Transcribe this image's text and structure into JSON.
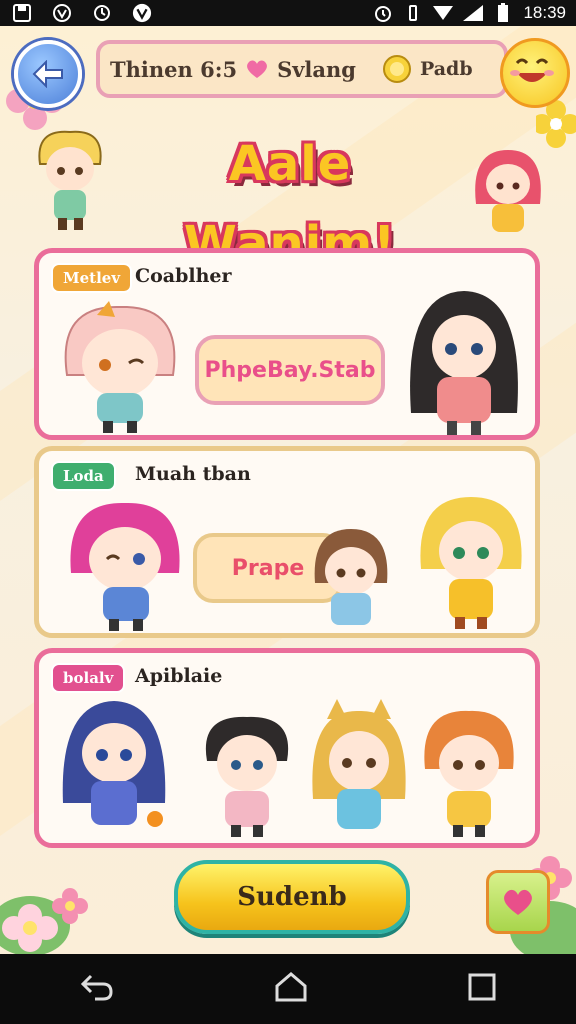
{
  "status_bar": {
    "time": "18:39"
  },
  "header": {
    "stat_label": "Thinen 6:5",
    "currency_label": "Svlang",
    "coin_label": "Padb"
  },
  "title": "Aale Wanim!",
  "cards": [
    {
      "tag": "Metlev",
      "heading": "Coablher",
      "bubble_text": "PhpeBay.Stab",
      "tag_color": "#f0a637"
    },
    {
      "tag": "Loda",
      "heading": "Muah tban",
      "bubble_text": "Prape",
      "tag_color": "#3fae6f"
    },
    {
      "tag": "bolalv",
      "heading": "Apiblaie",
      "tag_color": "#e2508f"
    }
  ],
  "submit_button": "Sudenb",
  "colors": {
    "card_border_pink": "#ea6d9a",
    "card_border_gold": "#e9c98a",
    "accent_teal": "#2fb3a5"
  }
}
